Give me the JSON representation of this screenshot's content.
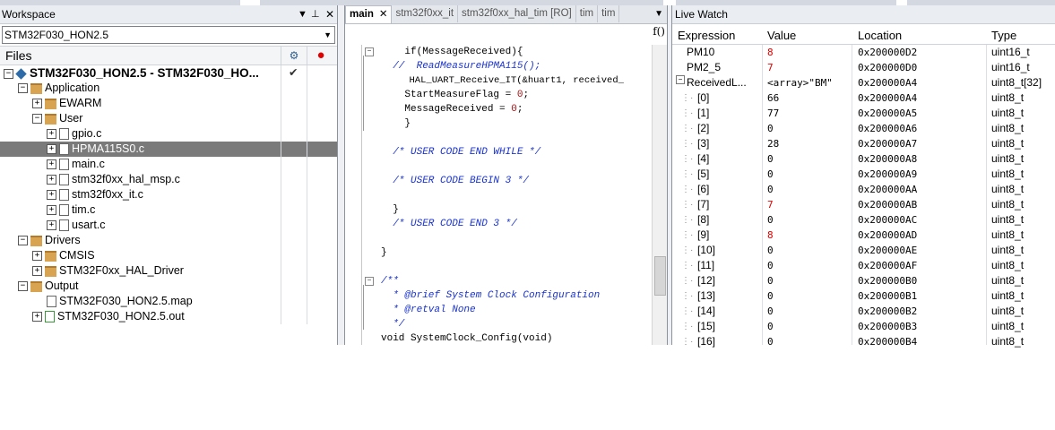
{
  "workspace": {
    "title": "Workspace",
    "config": "STM32F030_HON2.5",
    "files_label": "Files",
    "tree": [
      {
        "label": "STM32F030_HON2.5 - STM32F030_HO...",
        "type": "project",
        "level": 0,
        "exp": "−",
        "bold": true,
        "check": "✔"
      },
      {
        "label": "Application",
        "type": "folder",
        "level": 1,
        "exp": "−"
      },
      {
        "label": "EWARM",
        "type": "folder",
        "level": 2,
        "exp": "+"
      },
      {
        "label": "User",
        "type": "folder",
        "level": 2,
        "exp": "−"
      },
      {
        "label": "gpio.c",
        "type": "file",
        "level": 3,
        "exp": "+"
      },
      {
        "label": "HPMA115S0.c",
        "type": "file",
        "level": 3,
        "exp": "+",
        "selected": true
      },
      {
        "label": "main.c",
        "type": "file",
        "level": 3,
        "exp": "+"
      },
      {
        "label": "stm32f0xx_hal_msp.c",
        "type": "file",
        "level": 3,
        "exp": "+"
      },
      {
        "label": "stm32f0xx_it.c",
        "type": "file",
        "level": 3,
        "exp": "+"
      },
      {
        "label": "tim.c",
        "type": "file",
        "level": 3,
        "exp": "+"
      },
      {
        "label": "usart.c",
        "type": "file",
        "level": 3,
        "exp": "+"
      },
      {
        "label": "Drivers",
        "type": "folder",
        "level": 1,
        "exp": "−"
      },
      {
        "label": "CMSIS",
        "type": "folder",
        "level": 2,
        "exp": "+"
      },
      {
        "label": "STM32F0xx_HAL_Driver",
        "type": "folder",
        "level": 2,
        "exp": "+"
      },
      {
        "label": "Output",
        "type": "folder",
        "level": 1,
        "exp": "−"
      },
      {
        "label": "STM32F030_HON2.5.map",
        "type": "file",
        "level": 2,
        "exp": ""
      },
      {
        "label": "STM32F030_HON2.5.out",
        "type": "file-green",
        "level": 2,
        "exp": "+"
      }
    ]
  },
  "editor": {
    "tabs": [
      {
        "label": "main",
        "active": true,
        "close": "✕"
      },
      {
        "label": "stm32f0xx_it"
      },
      {
        "label": "stm32f0xx_hal_tim [RO]"
      },
      {
        "label": "tim"
      },
      {
        "label": "tim"
      }
    ],
    "fx_label": "f()",
    "lines": [
      {
        "fold": "−",
        "parts": [
          {
            "t": "    if(MessageReceived){",
            "c": ""
          }
        ]
      },
      {
        "parts": [
          {
            "t": "  //  ReadMeasureHPMA115();",
            "c": "cm"
          }
        ]
      },
      {
        "parts": [
          {
            "t": "     HAL_UART_Receive_IT(&huart1, received_",
            "c": "small"
          }
        ]
      },
      {
        "parts": [
          {
            "t": "    StartMeasureFlag = ",
            "c": ""
          },
          {
            "t": "0",
            "c": "num"
          },
          {
            "t": ";",
            "c": ""
          }
        ]
      },
      {
        "parts": [
          {
            "t": "    MessageReceived = ",
            "c": ""
          },
          {
            "t": "0",
            "c": "num"
          },
          {
            "t": ";",
            "c": ""
          }
        ]
      },
      {
        "parts": [
          {
            "t": "    }",
            "c": ""
          }
        ]
      },
      {
        "parts": [
          {
            "t": "",
            "c": ""
          }
        ]
      },
      {
        "parts": [
          {
            "t": "  /* USER CODE END WHILE */",
            "c": "cm"
          }
        ]
      },
      {
        "parts": [
          {
            "t": "",
            "c": ""
          }
        ]
      },
      {
        "parts": [
          {
            "t": "  /* USER CODE BEGIN 3 */",
            "c": "cm"
          }
        ]
      },
      {
        "parts": [
          {
            "t": "",
            "c": ""
          }
        ]
      },
      {
        "parts": [
          {
            "t": "  }",
            "c": ""
          }
        ]
      },
      {
        "parts": [
          {
            "t": "  /* USER CODE END 3 */",
            "c": "cm"
          }
        ]
      },
      {
        "parts": [
          {
            "t": "",
            "c": ""
          }
        ]
      },
      {
        "parts": [
          {
            "t": "}",
            "c": ""
          }
        ]
      },
      {
        "parts": [
          {
            "t": "",
            "c": ""
          }
        ]
      },
      {
        "fold": "−",
        "parts": [
          {
            "t": "/**",
            "c": "cm"
          }
        ]
      },
      {
        "parts": [
          {
            "t": "  * @brief System Clock Configuration",
            "c": "cm"
          }
        ]
      },
      {
        "parts": [
          {
            "t": "  * @retval None",
            "c": "cm"
          }
        ]
      },
      {
        "parts": [
          {
            "t": "  */",
            "c": "cm"
          }
        ]
      },
      {
        "parts": [
          {
            "t": "void SystemClock_Config(void)",
            "c": ""
          }
        ]
      }
    ]
  },
  "live_watch": {
    "title": "Live Watch",
    "columns": [
      "Expression",
      "Value",
      "Location",
      "Type"
    ],
    "rows": [
      {
        "expr": "PM10",
        "value": "8",
        "value_red": true,
        "loc": "0x200000D2",
        "type": "uint16_t",
        "indent": 1
      },
      {
        "expr": "PM2_5",
        "value": "7",
        "value_red": true,
        "loc": "0x200000D0",
        "type": "uint16_t",
        "indent": 1
      },
      {
        "expr": "ReceivedL...",
        "value": "<array>\"BM\"",
        "loc": "0x200000A4",
        "type": "uint8_t[32]",
        "indent": 0,
        "exp": "−"
      },
      {
        "expr": "[0]",
        "value": "66",
        "loc": "0x200000A4",
        "type": "uint8_t",
        "indent": 2
      },
      {
        "expr": "[1]",
        "value": "77",
        "loc": "0x200000A5",
        "type": "uint8_t",
        "indent": 2
      },
      {
        "expr": "[2]",
        "value": "0",
        "loc": "0x200000A6",
        "type": "uint8_t",
        "indent": 2
      },
      {
        "expr": "[3]",
        "value": "28",
        "loc": "0x200000A7",
        "type": "uint8_t",
        "indent": 2
      },
      {
        "expr": "[4]",
        "value": "0",
        "loc": "0x200000A8",
        "type": "uint8_t",
        "indent": 2
      },
      {
        "expr": "[5]",
        "value": "0",
        "loc": "0x200000A9",
        "type": "uint8_t",
        "indent": 2
      },
      {
        "expr": "[6]",
        "value": "0",
        "loc": "0x200000AA",
        "type": "uint8_t",
        "indent": 2
      },
      {
        "expr": "[7]",
        "value": "7",
        "value_red": true,
        "loc": "0x200000AB",
        "type": "uint8_t",
        "indent": 2
      },
      {
        "expr": "[8]",
        "value": "0",
        "loc": "0x200000AC",
        "type": "uint8_t",
        "indent": 2
      },
      {
        "expr": "[9]",
        "value": "8",
        "value_red": true,
        "loc": "0x200000AD",
        "type": "uint8_t",
        "indent": 2
      },
      {
        "expr": "[10]",
        "value": "0",
        "loc": "0x200000AE",
        "type": "uint8_t",
        "indent": 2
      },
      {
        "expr": "[11]",
        "value": "0",
        "loc": "0x200000AF",
        "type": "uint8_t",
        "indent": 2
      },
      {
        "expr": "[12]",
        "value": "0",
        "loc": "0x200000B0",
        "type": "uint8_t",
        "indent": 2
      },
      {
        "expr": "[13]",
        "value": "0",
        "loc": "0x200000B1",
        "type": "uint8_t",
        "indent": 2
      },
      {
        "expr": "[14]",
        "value": "0",
        "loc": "0x200000B2",
        "type": "uint8_t",
        "indent": 2
      },
      {
        "expr": "[15]",
        "value": "0",
        "loc": "0x200000B3",
        "type": "uint8_t",
        "indent": 2
      },
      {
        "expr": "[16]",
        "value": "0",
        "loc": "0x200000B4",
        "type": "uint8_t",
        "indent": 2
      }
    ]
  },
  "colors": {
    "red_value": "#e00000",
    "comment": "#1a33cc",
    "selection": "#7a7a7a"
  }
}
